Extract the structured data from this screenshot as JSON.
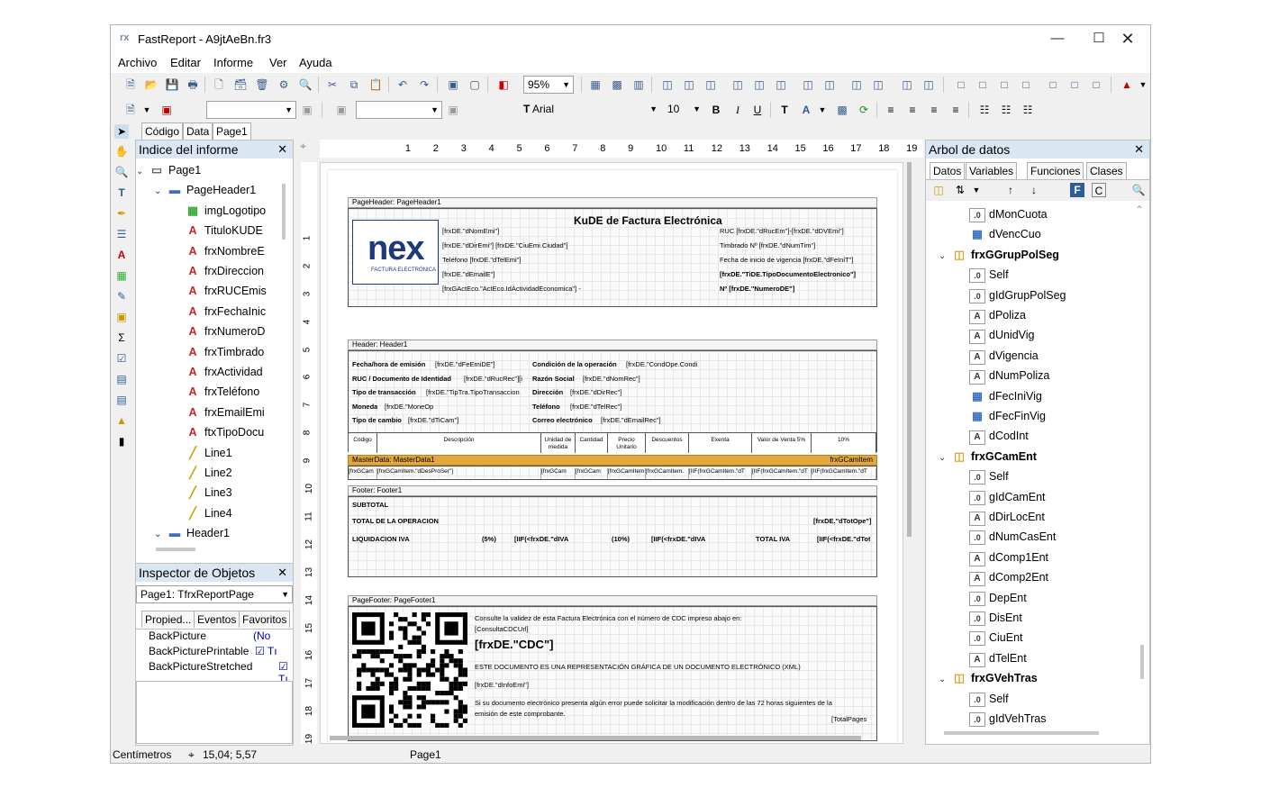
{
  "window": {
    "title": "FastReport - A9jtAeBn.fr3",
    "app_icon": "fastreport-icon"
  },
  "menu": [
    "Archivo",
    "Editar",
    "Informe",
    "Ver",
    "Ayuda"
  ],
  "toolbar": {
    "zoom": "95%",
    "font": "Arial",
    "size": "10"
  },
  "report_index": {
    "title": "Indice del informe",
    "items": [
      {
        "label": "Page1",
        "level": 0,
        "icon": "page-icon"
      },
      {
        "label": "PageHeader1",
        "level": 1,
        "icon": "band-icon"
      },
      {
        "label": "imgLogotipo",
        "level": 2,
        "icon": "picture-icon"
      },
      {
        "label": "TituloKUDE",
        "level": 2,
        "icon": "text-icon"
      },
      {
        "label": "frxNombreE",
        "level": 2,
        "icon": "text-icon"
      },
      {
        "label": "frxDireccion",
        "level": 2,
        "icon": "text-icon"
      },
      {
        "label": "frxRUCEmis",
        "level": 2,
        "icon": "text-icon"
      },
      {
        "label": "frxFechaInic",
        "level": 2,
        "icon": "text-icon"
      },
      {
        "label": "frxNumeroD",
        "level": 2,
        "icon": "text-icon"
      },
      {
        "label": "frxTimbrado",
        "level": 2,
        "icon": "text-icon"
      },
      {
        "label": "frxActividad",
        "level": 2,
        "icon": "text-icon"
      },
      {
        "label": "frxTeléfono",
        "level": 2,
        "icon": "text-icon"
      },
      {
        "label": "frxEmailEmi",
        "level": 2,
        "icon": "text-icon"
      },
      {
        "label": "ftxTipoDocu",
        "level": 2,
        "icon": "text-icon"
      },
      {
        "label": "Line1",
        "level": 2,
        "icon": "line-icon"
      },
      {
        "label": "Line2",
        "level": 2,
        "icon": "line-icon"
      },
      {
        "label": "Line3",
        "level": 2,
        "icon": "line-icon"
      },
      {
        "label": "Line4",
        "level": 2,
        "icon": "line-icon"
      },
      {
        "label": "Header1",
        "level": 1,
        "icon": "band-icon"
      }
    ]
  },
  "doc_tabs": [
    "Código",
    "Data",
    "Page1"
  ],
  "inspector": {
    "title": "Inspector de Objetos",
    "selected": "Page1: TfrxReportPage",
    "tabs": [
      "Propied...",
      "Eventos",
      "Favoritos"
    ],
    "props": [
      {
        "name": "BackPicture",
        "value": "(No"
      },
      {
        "name": "BackPicturePrintable",
        "value": "Tı"
      },
      {
        "name": "BackPictureStretched",
        "value": "Tı"
      }
    ]
  },
  "data_tree": {
    "title": "Arbol de datos",
    "tabs": [
      "Datos",
      "Variables",
      "Funciones",
      "Clases"
    ],
    "items": [
      {
        "label": "dMonCuota",
        "level": 2,
        "icon": "number-icon"
      },
      {
        "label": "dVencCuo",
        "level": 2,
        "icon": "date-icon"
      },
      {
        "label": "frxGGrupPolSeg",
        "level": 1,
        "icon": "database-icon"
      },
      {
        "label": "Self",
        "level": 2,
        "icon": "number-icon"
      },
      {
        "label": "gIdGrupPolSeg",
        "level": 2,
        "icon": "number-icon"
      },
      {
        "label": "dPoliza",
        "level": 2,
        "icon": "text-icon"
      },
      {
        "label": "dUnidVig",
        "level": 2,
        "icon": "text-icon"
      },
      {
        "label": "dVigencia",
        "level": 2,
        "icon": "text-icon"
      },
      {
        "label": "dNumPoliza",
        "level": 2,
        "icon": "text-icon"
      },
      {
        "label": "dFecIniVig",
        "level": 2,
        "icon": "date-icon"
      },
      {
        "label": "dFecFinVig",
        "level": 2,
        "icon": "date-icon"
      },
      {
        "label": "dCodInt",
        "level": 2,
        "icon": "text-icon"
      },
      {
        "label": "frxGCamEnt",
        "level": 1,
        "icon": "database-icon"
      },
      {
        "label": "Self",
        "level": 2,
        "icon": "number-icon"
      },
      {
        "label": "gIdCamEnt",
        "level": 2,
        "icon": "number-icon"
      },
      {
        "label": "dDirLocEnt",
        "level": 2,
        "icon": "text-icon"
      },
      {
        "label": "dNumCasEnt",
        "level": 2,
        "icon": "number-icon"
      },
      {
        "label": "dComp1Ent",
        "level": 2,
        "icon": "text-icon"
      },
      {
        "label": "dComp2Ent",
        "level": 2,
        "icon": "text-icon"
      },
      {
        "label": "DepEnt",
        "level": 2,
        "icon": "number-icon"
      },
      {
        "label": "DisEnt",
        "level": 2,
        "icon": "number-icon"
      },
      {
        "label": "CiuEnt",
        "level": 2,
        "icon": "number-icon"
      },
      {
        "label": "dTelEnt",
        "level": 2,
        "icon": "text-icon"
      },
      {
        "label": "frxGVehTras",
        "level": 1,
        "icon": "database-icon"
      },
      {
        "label": "Self",
        "level": 2,
        "icon": "number-icon"
      },
      {
        "label": "gIdVehTras",
        "level": 2,
        "icon": "number-icon"
      }
    ]
  },
  "report": {
    "page_header_label": "PageHeader: PageHeader1",
    "kude_title": "KuDE de Factura Electrónica",
    "logo_text": "nex",
    "logo_sub": "FACTURA ELECTRÓNICA",
    "emisor_lines": [
      "[frxDE.\"dNomEmi\"]",
      "[frxDE.\"dDirEmi\"] [frxDE.\"CiuEmi.Ciudad\"]",
      "Teléfono [frxDE.\"dTelEmi\"]",
      "[frxDE.\"dEmailE\"]",
      "[frxGActEco.\"ActEco.IdActividadEconomica\"] -"
    ],
    "timbrado_lines": [
      "RUC [frxDE.\"dRucEm\"]-[frxDE.\"dDVEmi\"]",
      "Timbrado Nº [frxDE.\"dNumTim\"]",
      "Fecha de inicio de vigencia [frxDE.\"dFeIniT\"]",
      "[frxDE.\"TiDE.TipoDocumentoElectronico\"]",
      "Nº [frxDE.\"NumeroDE\"]"
    ],
    "header_label": "Header: Header1",
    "header_left": [
      [
        "Fecha/hora de emisión",
        "[frxDE.\"dFeEmiDE\"]"
      ],
      [
        "RUC / Documento de Identidad",
        "[frxDE.\"dRucRec\"][i"
      ],
      [
        "Tipo de transacción",
        "[frxDE.\"TipTra.TipoTransaccion"
      ],
      [
        "Moneda",
        "[frxDE.\"MoneOp"
      ],
      [
        "Tipo de cambio",
        "[frxDE.\"dTiCam\"]"
      ]
    ],
    "header_right": [
      [
        "Condición de la operación",
        "[frxDE.\"CondOpe.Condi"
      ],
      [
        "Razón Social",
        "[frxDE.\"dNomRec\"]"
      ],
      [
        "Dirección",
        "[frxDE.\"dDirRec\"]"
      ],
      [
        "Teléfono",
        "[frxDE.\"dTelRec\"]"
      ],
      [
        "Correo electrónico",
        "[frxDE.\"dEmailRec\"]"
      ]
    ],
    "columns": [
      "Código",
      "Descripción",
      "Unidad de medida",
      "Cantidad",
      "Precio Unitario",
      "Descuentos",
      "Exenta",
      "Valor de Venta 5%",
      "10%"
    ],
    "master_label": "MasterData: MasterData1",
    "master_ds": "frxGCamItem",
    "master_cells": [
      "[frxGCam",
      "[frxGCamItem.\"dDesProSer\"]",
      "[frxGCam",
      "[frxGCam",
      "[frxGCamItem.",
      "[frxGCamItem.",
      "[IIF(frxGCamItem.\"dT",
      "[IIF(frxGCamItem.\"dT",
      "[IIF(frxGCamItem.\"dT"
    ],
    "footer_label": "Footer: Footer1",
    "subtotal": "SUBTOTAL",
    "total_op": "TOTAL DE LA OPERACION",
    "total_val": "[frxDE.\"dTotOpe\"]",
    "liq": "LIQUIDACION IVA",
    "liq5": "(5%)",
    "liq5v": "[IIF(<frxDE.\"dIVA",
    "liq10": "(10%)",
    "liq10v": "[IIF(<frxDE.\"dIVA",
    "totiva": "TOTAL IVA",
    "totivav": "[IIF(<frxDE.\"dTot",
    "pagefooter_label": "PageFooter: PageFooter1",
    "pf_line1": "Consulte la validez de esta Factura Electrónica con el número de CDC impreso abajo en:",
    "pf_line2": "[ConsultaCDCUrl]",
    "pf_cdc": "[frxDE.\"CDC\"]",
    "pf_line3": "ESTE DOCUMENTO ES UNA REPRESENTACIÓN GRÁFICA DE UN DOCUMENTO ELECTRÓNICO (XML)",
    "pf_line4": "[frxDE.\"dInfoEmi\"]",
    "pf_line5": "Si su documento electrónico presenta algún error puede solicitar la modificación dentro de las 72 horas siguientes de la",
    "pf_line6": "emisión de este comprobante.",
    "pf_pages": "[TotalPages"
  },
  "status": {
    "units": "Centímetros",
    "coords": "15,04; 5,57",
    "page": "Page1"
  }
}
